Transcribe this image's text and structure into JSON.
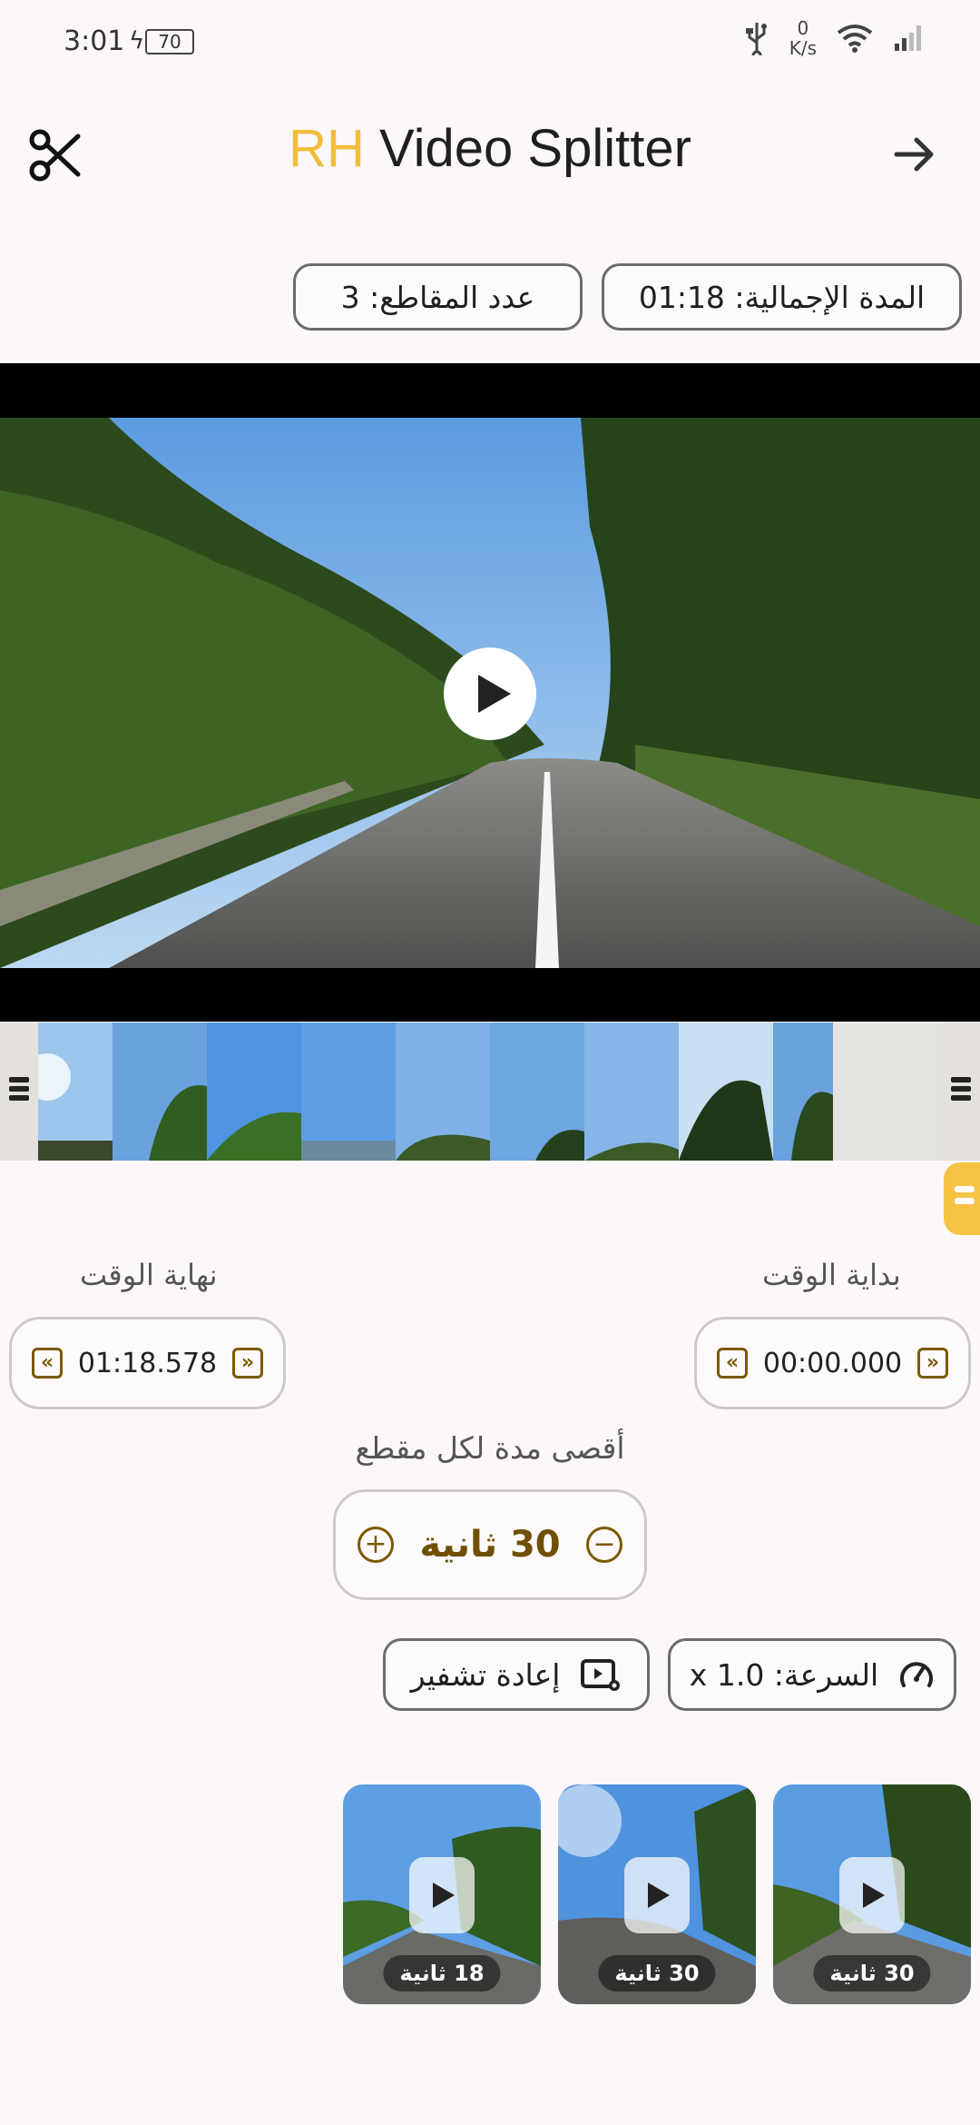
{
  "status_bar": {
    "time": "3:01",
    "battery": "70",
    "net_speed_value": "0",
    "net_speed_unit": "K/s"
  },
  "header": {
    "title_accent": "RH",
    "title_rest": "Video Splitter",
    "accent_color": "#f2bd3c"
  },
  "info": {
    "total_duration": "المدة الإجمالية: 01:18",
    "clip_count": "عدد المقاطع: 3"
  },
  "trim": {
    "start_label": "بداية الوقت",
    "start_value": "00:00.000",
    "end_label": "نهاية الوقت",
    "end_value": "01:18.578"
  },
  "max_duration": {
    "label": "أقصى مدة لكل مقطع",
    "value": "30 ثانية"
  },
  "actions": {
    "speed": "السرعة: 1.0 x",
    "reencode": "إعادة تشفير"
  },
  "clips": [
    {
      "duration": "30 ثانية"
    },
    {
      "duration": "30 ثانية"
    },
    {
      "duration": "18 ثانية"
    }
  ]
}
